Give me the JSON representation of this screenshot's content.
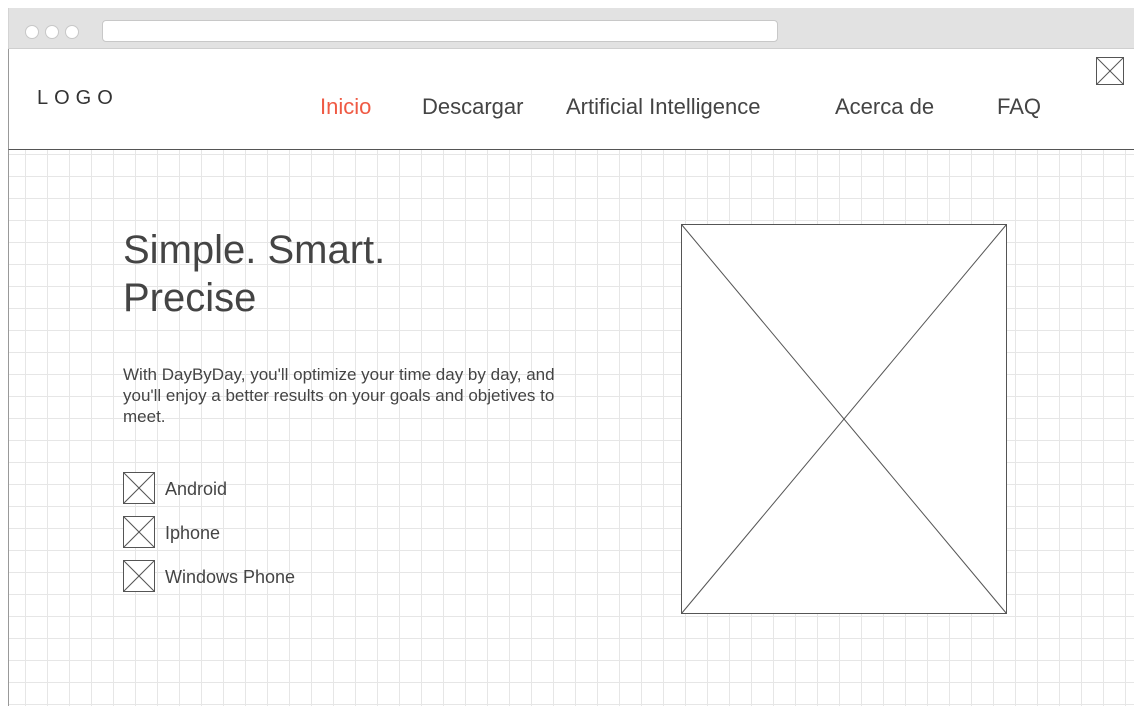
{
  "header": {
    "logo": "LOGO",
    "nav": [
      {
        "label": "Inicio",
        "active": true
      },
      {
        "label": "Descargar"
      },
      {
        "label": "Artificial Intelligence"
      },
      {
        "label": "Acerca de"
      },
      {
        "label": "FAQ"
      }
    ],
    "active_color": "#ef5a44"
  },
  "hero": {
    "headline_line1": "Simple. Smart.",
    "headline_line2": "Precise",
    "description": "With DayByDay, you'll optimize your time day by day, and you'll enjoy a better results on your goals and objetives to meet.",
    "platforms": [
      {
        "label": "Android",
        "icon": "image-placeholder-icon"
      },
      {
        "label": "Iphone",
        "icon": "image-placeholder-icon"
      },
      {
        "label": "Windows Phone",
        "icon": "image-placeholder-icon"
      }
    ],
    "image": "image-placeholder"
  }
}
